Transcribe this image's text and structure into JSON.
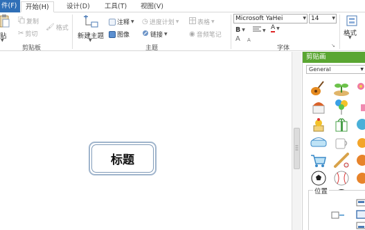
{
  "tabs": {
    "file": "件(F)",
    "home": "开始(H)",
    "design": "设计(D)",
    "tools": "工具(T)",
    "view": "视图(V)"
  },
  "clipboard": {
    "paste": "贴",
    "copy": "复制",
    "cut": "剪切",
    "format": "格式",
    "group": "剪贴板"
  },
  "topic_group": {
    "new_topic": "新建主题",
    "note": "注释",
    "progress": "进度计划",
    "table": "表格",
    "image": "图像",
    "link": "链接",
    "audio": "音频笔记",
    "group": "主题"
  },
  "font_group": {
    "font_name": "Microsoft YaHei",
    "font_size": "14",
    "bold": "B",
    "grow": "A",
    "shrink": "A",
    "format": "格式",
    "group": "字体"
  },
  "canvas": {
    "topic_text": "标题"
  },
  "clipart_panel": {
    "title": "剪贴画",
    "category": "General",
    "position_label": "位置"
  },
  "colors": {
    "file_tab": "#2f6fb7",
    "panel_header": "#5aa632",
    "topic_border": "#9fb4cc"
  }
}
